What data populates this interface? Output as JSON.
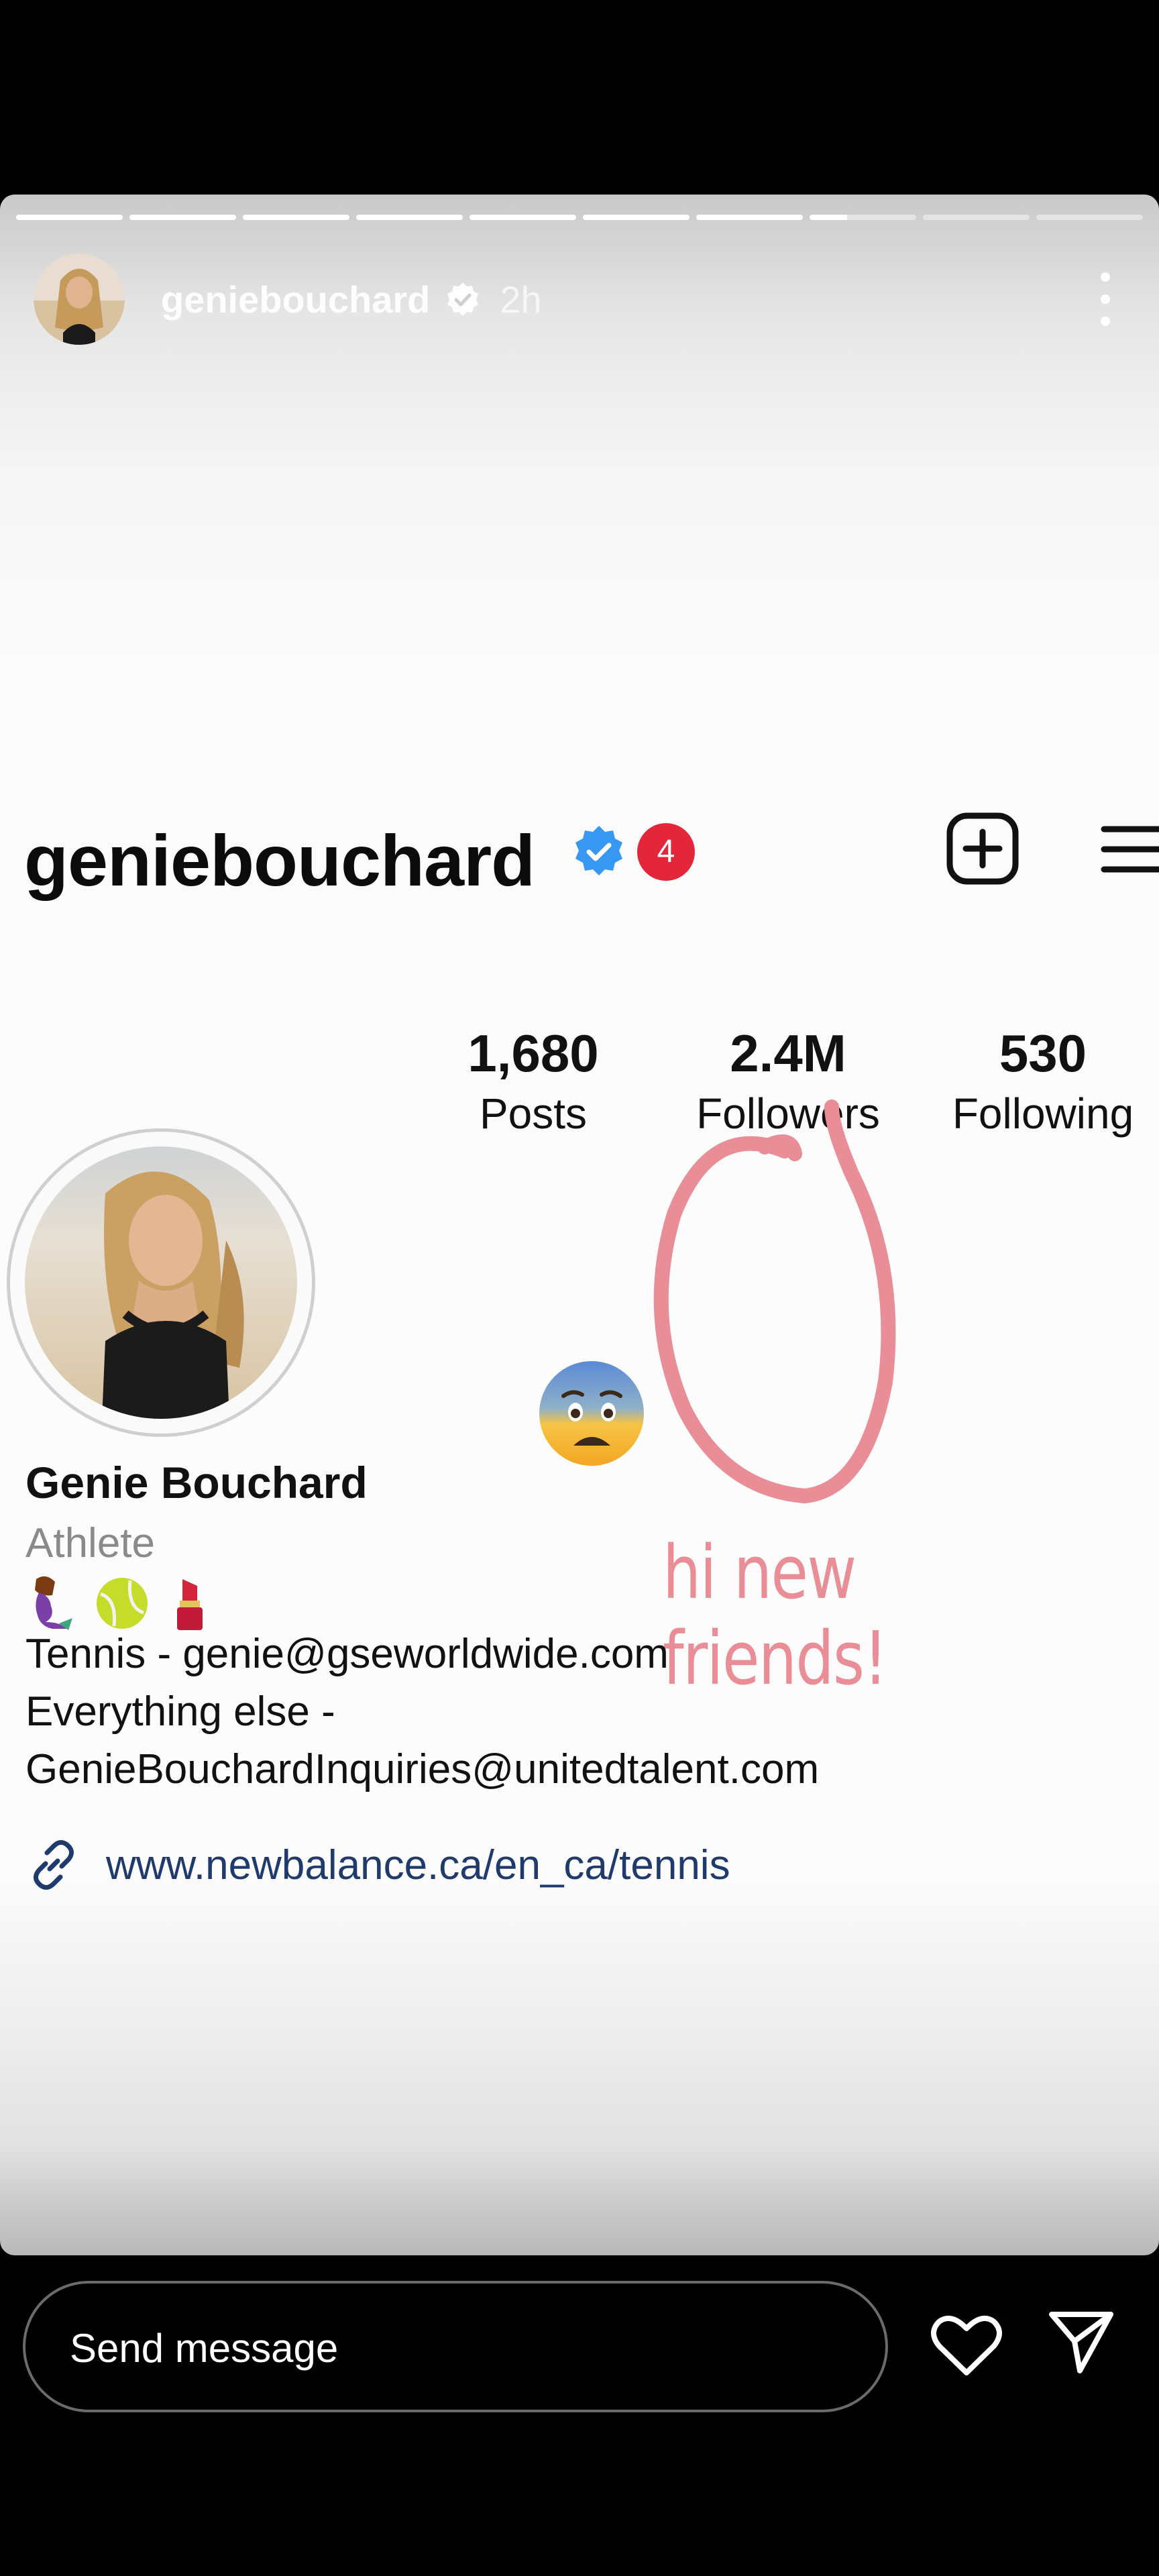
{
  "story": {
    "username": "geniebouchard",
    "timestamp": "2h",
    "progress": {
      "segments": 10,
      "current_index": 7,
      "current_fraction": 0.35
    }
  },
  "profile": {
    "username": "geniebouchard",
    "notification_count": "4",
    "stats": [
      {
        "value": "1,680",
        "label": "Posts"
      },
      {
        "value": "2.4M",
        "label": "Followers"
      },
      {
        "value": "530",
        "label": "Following"
      }
    ],
    "name": "Genie Bouchard",
    "category": "Athlete",
    "bio_emojis": [
      "mermaid",
      "tennis-ball",
      "lipstick"
    ],
    "bio_lines": [
      "Tennis - genie@gseworldwide.com",
      "Everything else -",
      "GenieBouchardInquiries@unitedtalent.com"
    ],
    "link": "www.newbalance.ca/en_ca/tennis"
  },
  "annotations": {
    "handwriting": "hi new friends!",
    "circle_color": "#e98d96",
    "emoji": "fearful-face"
  },
  "reply": {
    "placeholder": "Send message"
  },
  "colors": {
    "verified_blue": "#3897f0",
    "badge_red": "#e3263a",
    "link_blue": "#1f3b6e"
  }
}
